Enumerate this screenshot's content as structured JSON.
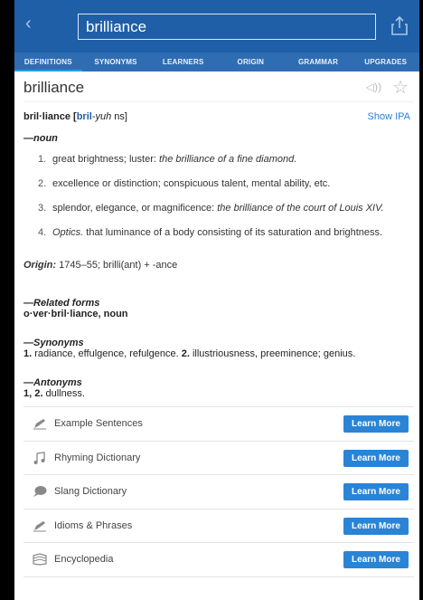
{
  "header": {
    "back_glyph": "‹",
    "search_value": "brilliance"
  },
  "tabs": [
    "DEFINITIONS",
    "SYNONYMS",
    "LEARNERS",
    "ORIGIN",
    "GRAMMAR",
    "UPGRADES"
  ],
  "entry": {
    "word": "brilliance",
    "pron_pre": "bril·liance [",
    "pron_stress": "bril",
    "pron_mid": "-",
    "pron_yuh": "yuh",
    "pron_post": " ns]",
    "show_ipa": "Show IPA",
    "pos": "—noun",
    "definitions": [
      {
        "num": "1.",
        "text": "great brightness; luster: ",
        "example": "the brilliance of a fine diamond."
      },
      {
        "num": "2.",
        "text": "excellence or distinction; conspicuous talent, mental ability, etc.",
        "example": ""
      },
      {
        "num": "3.",
        "text": "splendor, elegance, or magnificence: ",
        "example": "the brilliance of the court of Louis XIV."
      },
      {
        "num": "4.",
        "label": "Optics.",
        "text": " that luminance of a body consisting of its saturation and brightness.",
        "example": ""
      }
    ],
    "origin_label": "Origin:",
    "origin_text": " 1745–55; brilli(ant) + -ance",
    "related_title": "—Related forms",
    "related_text": "o·ver·bril·liance, noun",
    "synonyms_title": "—Synonyms",
    "syn_1": "1.",
    "syn_1_text": " radiance, effulgence, refulgence. ",
    "syn_2": "2.",
    "syn_2_text": " illustriousness, preeminence; genius.",
    "antonyms_title": "—Antonyms",
    "ant_num": "1, 2.",
    "ant_text": " dullness."
  },
  "more": [
    {
      "label": "Example Sentences",
      "icon": "pencil-icon"
    },
    {
      "label": "Rhyming Dictionary",
      "icon": "music-note-icon"
    },
    {
      "label": "Slang Dictionary",
      "icon": "speech-bubble-icon"
    },
    {
      "label": "Idioms & Phrases",
      "icon": "pencil-icon"
    },
    {
      "label": "Encyclopedia",
      "icon": "book-icon"
    }
  ],
  "learn_more_label": "Learn More"
}
